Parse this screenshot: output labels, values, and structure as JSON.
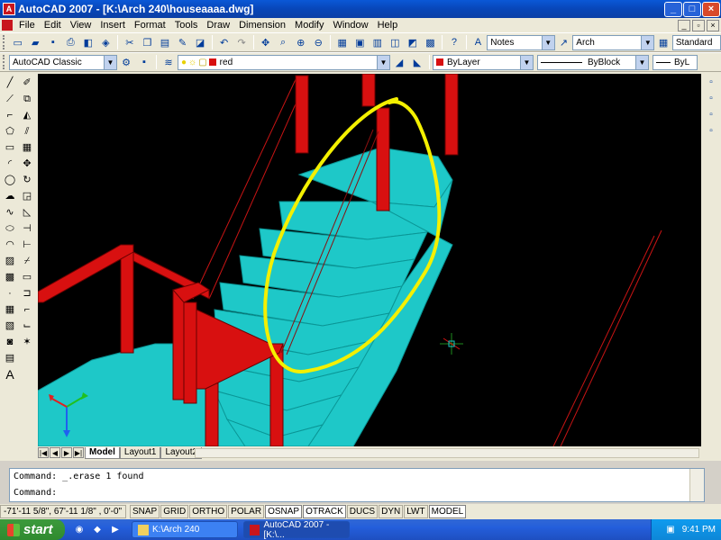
{
  "window": {
    "title": "AutoCAD 2007 - [K:\\Arch 240\\houseaaaa.dwg]",
    "minimize": "_",
    "maximize": "□",
    "close": "×"
  },
  "menu": {
    "items": [
      "File",
      "Edit",
      "View",
      "Insert",
      "Format",
      "Tools",
      "Draw",
      "Dimension",
      "Modify",
      "Window",
      "Help"
    ]
  },
  "toolbar": {
    "text_style": "Notes",
    "dim_style": "Arch",
    "table_style": "Standard",
    "workspace": "AutoCAD Classic",
    "layer": "red",
    "color": "ByLayer",
    "linetype": "ByBlock",
    "lineweight": "ByL"
  },
  "layout_tabs": {
    "items": [
      "Model",
      "Layout1",
      "Layout2"
    ],
    "active": "Model"
  },
  "command": {
    "history": "Command:  _.erase 1 found",
    "prompt": "Command:"
  },
  "status": {
    "coords": "-71'-11 5/8\", 67'-11 1/8\" , 0'-0\"",
    "buttons": [
      "SNAP",
      "GRID",
      "ORTHO",
      "POLAR",
      "OSNAP",
      "OTRACK",
      "DUCS",
      "DYN",
      "LWT",
      "MODEL"
    ]
  },
  "taskbar": {
    "start": "start",
    "tasks": [
      "K:\\Arch 240",
      "AutoCAD 2007 - [K:\\..."
    ],
    "clock": "9:41 PM"
  },
  "colors": {
    "stair_cyan": "#1ec8c8",
    "rail_red": "#d81010",
    "highlight_yellow": "#f4f000",
    "canvas_black": "#000000"
  },
  "icons": [
    "new-icon",
    "open-icon",
    "save-icon",
    "undo-icon",
    "redo-icon",
    "pan-icon",
    "zoom-icon",
    "line-tool-icon",
    "circle-tool-icon",
    "move-icon",
    "erase-icon",
    "ucs-icon"
  ]
}
